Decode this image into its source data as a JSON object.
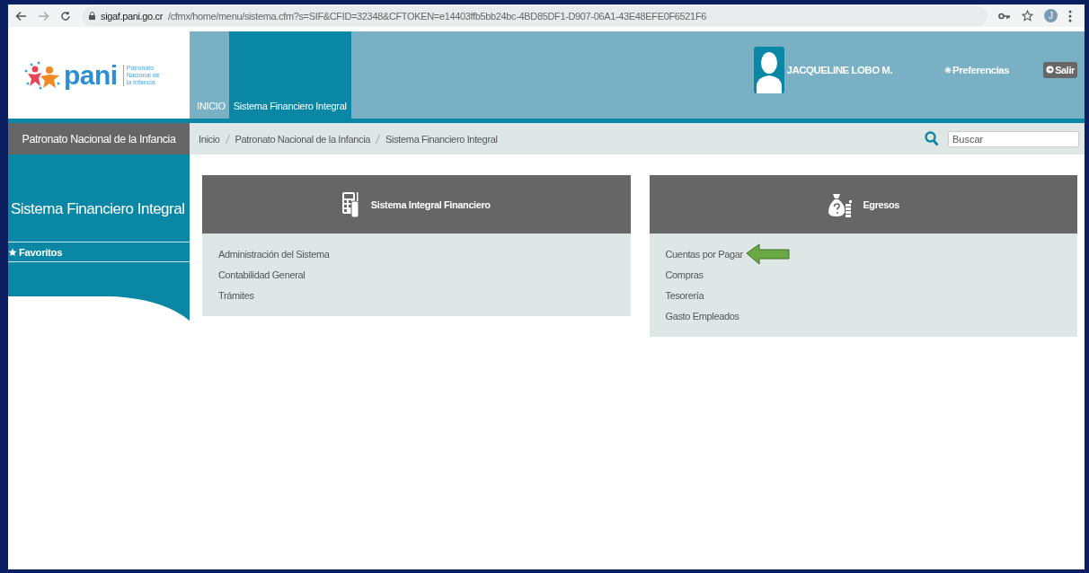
{
  "browser": {
    "url_host": "sigaf.pani.go.cr",
    "url_path": "/cfmx/home/menu/sistema.cfm?s=SIF&CFID=32348&CFTOKEN=e14403ffb5bb24bc-4BD85DF1-D907-06A1-43E48EFE0F6521F6",
    "profile_initial": "J"
  },
  "header": {
    "logo": {
      "name": "pani",
      "subtitle_lines": [
        "Patronato",
        "Nacional de",
        "la Infancia"
      ]
    },
    "tabs": [
      {
        "label": "INICIO",
        "selected": false
      },
      {
        "label": "Sistema Financiero Integral",
        "selected": true
      }
    ],
    "user": {
      "name": "JACQUELINE LOBO M."
    },
    "preferences": "Preferencias",
    "logout": "Salir"
  },
  "sidebar": {
    "org": "Patronato Nacional de la Infancia",
    "title": "Sistema Financiero Integral",
    "items": [
      {
        "label": "Favoritos"
      }
    ]
  },
  "breadcrumb": [
    "Inicio",
    "Patronato Nacional de la Infancia",
    "Sistema Financiero Integral"
  ],
  "search": {
    "placeholder": "Buscar"
  },
  "cards": [
    {
      "title": "Sistema Integral Financiero",
      "items": [
        {
          "label": "Administración del Sistema",
          "pointed": false
        },
        {
          "label": "Contabilidad General",
          "pointed": false
        },
        {
          "label": "Trámites",
          "pointed": false
        }
      ]
    },
    {
      "title": "Egresos",
      "items": [
        {
          "label": "Cuentas por Pagar",
          "pointed": true
        },
        {
          "label": "Compras",
          "pointed": false
        },
        {
          "label": "Tesorería",
          "pointed": false
        },
        {
          "label": "Gasto Empleados",
          "pointed": false
        }
      ]
    }
  ]
}
